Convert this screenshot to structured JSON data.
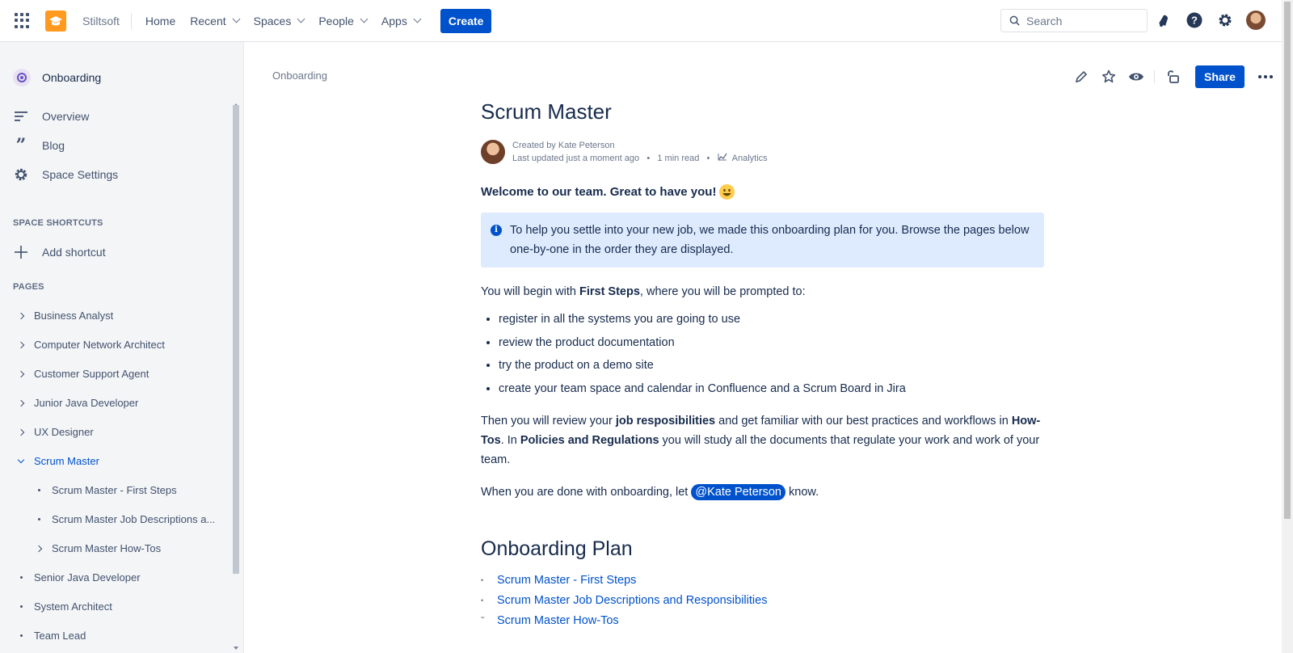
{
  "topbar": {
    "brand": "Stiltsoft",
    "nav": [
      {
        "label": "Home",
        "dropdown": false
      },
      {
        "label": "Recent",
        "dropdown": true
      },
      {
        "label": "Spaces",
        "dropdown": true
      },
      {
        "label": "People",
        "dropdown": true
      },
      {
        "label": "Apps",
        "dropdown": true
      }
    ],
    "create_label": "Create",
    "search_placeholder": "Search"
  },
  "sidebar": {
    "space_name": "Onboarding",
    "links": [
      {
        "label": "Overview",
        "icon": "overview-icon"
      },
      {
        "label": "Blog",
        "icon": "quote-icon"
      },
      {
        "label": "Space Settings",
        "icon": "gear-icon"
      }
    ],
    "shortcuts_title": "SPACE SHORTCUTS",
    "add_shortcut": "Add shortcut",
    "pages_title": "PAGES",
    "pages": [
      {
        "label": "Business Analyst",
        "marker": "arrow",
        "level": 0
      },
      {
        "label": "Computer Network Architect",
        "marker": "arrow",
        "level": 0
      },
      {
        "label": "Customer Support Agent",
        "marker": "arrow",
        "level": 0
      },
      {
        "label": "Junior Java Developer",
        "marker": "arrow",
        "level": 0
      },
      {
        "label": "UX Designer",
        "marker": "arrow",
        "level": 0
      },
      {
        "label": "Scrum Master",
        "marker": "open",
        "level": 0,
        "active": true
      },
      {
        "label": "Scrum Master - First Steps",
        "marker": "dot",
        "level": 1
      },
      {
        "label": "Scrum Master Job Descriptions a...",
        "marker": "dot",
        "level": 1
      },
      {
        "label": "Scrum Master How-Tos",
        "marker": "arrow",
        "level": 1
      },
      {
        "label": "Senior Java Developer",
        "marker": "dot",
        "level": 0
      },
      {
        "label": "System Architect",
        "marker": "dot",
        "level": 0
      },
      {
        "label": "Team Lead",
        "marker": "dot",
        "level": 0
      }
    ]
  },
  "page": {
    "breadcrumb": "Onboarding",
    "share_label": "Share",
    "title": "Scrum Master",
    "created_by": "Created by Kate Peterson",
    "last_updated": "Last updated just a moment ago",
    "read_time": "1 min read",
    "analytics": "Analytics",
    "welcome": "Welcome to our team. Great to have you!",
    "info_panel": "To help you settle into your new job, we made this onboarding plan for you. Browse the pages below one-by-one in the order they are displayed.",
    "intro_before": "You will begin with ",
    "intro_bold": "First Steps",
    "intro_after": ", where you will be prompted to:",
    "bullets": [
      "register in all the systems you are going to use",
      "review the product documentation",
      "try the product on a demo site",
      "create your team space and calendar in Confluence and a Scrum Board in Jira"
    ],
    "then_1": "Then you will review your ",
    "then_bold_1": "job resposibilities",
    "then_2": " and get familiar with our best practices and workflows in ",
    "then_bold_2": "How-Tos",
    "then_3": ". In ",
    "then_bold_3": "Policies and Regulations",
    "then_4": " you will study all the documents that regulate your work and work of your team.",
    "done_before": "When you are done with onboarding, let ",
    "mention": "@Kate Peterson",
    "done_after": " know.",
    "plan_title": "Onboarding Plan",
    "plan_items": [
      {
        "label": "Scrum Master - First Steps",
        "marker": "•"
      },
      {
        "label": "Scrum Master Job Descriptions and Responsibilities",
        "marker": "•"
      },
      {
        "label": "Scrum Master How-Tos",
        "marker": "ˇ"
      }
    ]
  },
  "colors": {
    "accent": "#0052CC",
    "logo": "#FF991F",
    "panel": "#DEEBFF"
  }
}
